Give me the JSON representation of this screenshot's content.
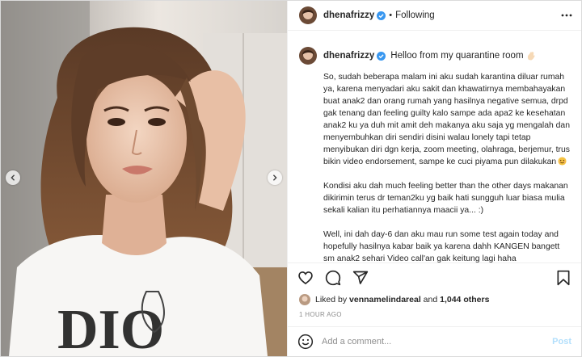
{
  "header": {
    "username": "dhenafrizzy",
    "separator": "•",
    "follow_status": "Following"
  },
  "caption": {
    "username": "dhenafrizzy",
    "headline": "Helloo from my quarantine room",
    "paragraphs": [
      "So, sudah beberapa malam ini aku sudah karantina diluar rumah ya, karena menyadari aku sakit dan khawatirnya membahayakan buat anak2 dan orang rumah yang hasilnya negative semua, drpd gak tenang dan feeling guilty kalo sampe ada apa2 ke kesehatan anak2 ku ya duh mit amit deh makanya aku saja yg mengalah dan menyembuhkan diri sendiri disini walau lonely tapi tetap menyibukan diri dgn kerja, zoom meeting, olahraga, berjemur, trus bikin video endorsement, sampe ke cuci piyama pun dilakukan",
      "Kondisi aku dah much feeling better than the other days makanan dikirimin terus dr teman2ku yg baik hati sungguh luar biasa mulia sekali kalian itu perhatiannya maacii ya... :)",
      "Well, ini dah day-6 dan aku mau run some test again today and hopefully hasilnya kabar baik ya karena dahh KANGEN bangett sm anak2 sehari Video call'an gak keitung lagi haha"
    ],
    "time": "1h"
  },
  "likes": {
    "prefix": "Liked by",
    "user": "vennamelindareal",
    "conjunction": "and",
    "count": "1,044 others"
  },
  "timestamp": "1 HOUR AGO",
  "comment": {
    "placeholder": "Add a comment...",
    "post_label": "Post"
  },
  "colors": {
    "verified": "#3897f0",
    "border": "#dbdbdb",
    "muted": "#8e8e8e",
    "post_disabled": "#b2dffc"
  },
  "icons": {
    "more": "more-horizontal-icon",
    "like": "heart-icon",
    "comment": "comment-icon",
    "share": "share-icon",
    "save": "bookmark-icon",
    "emoji": "emoji-icon"
  }
}
